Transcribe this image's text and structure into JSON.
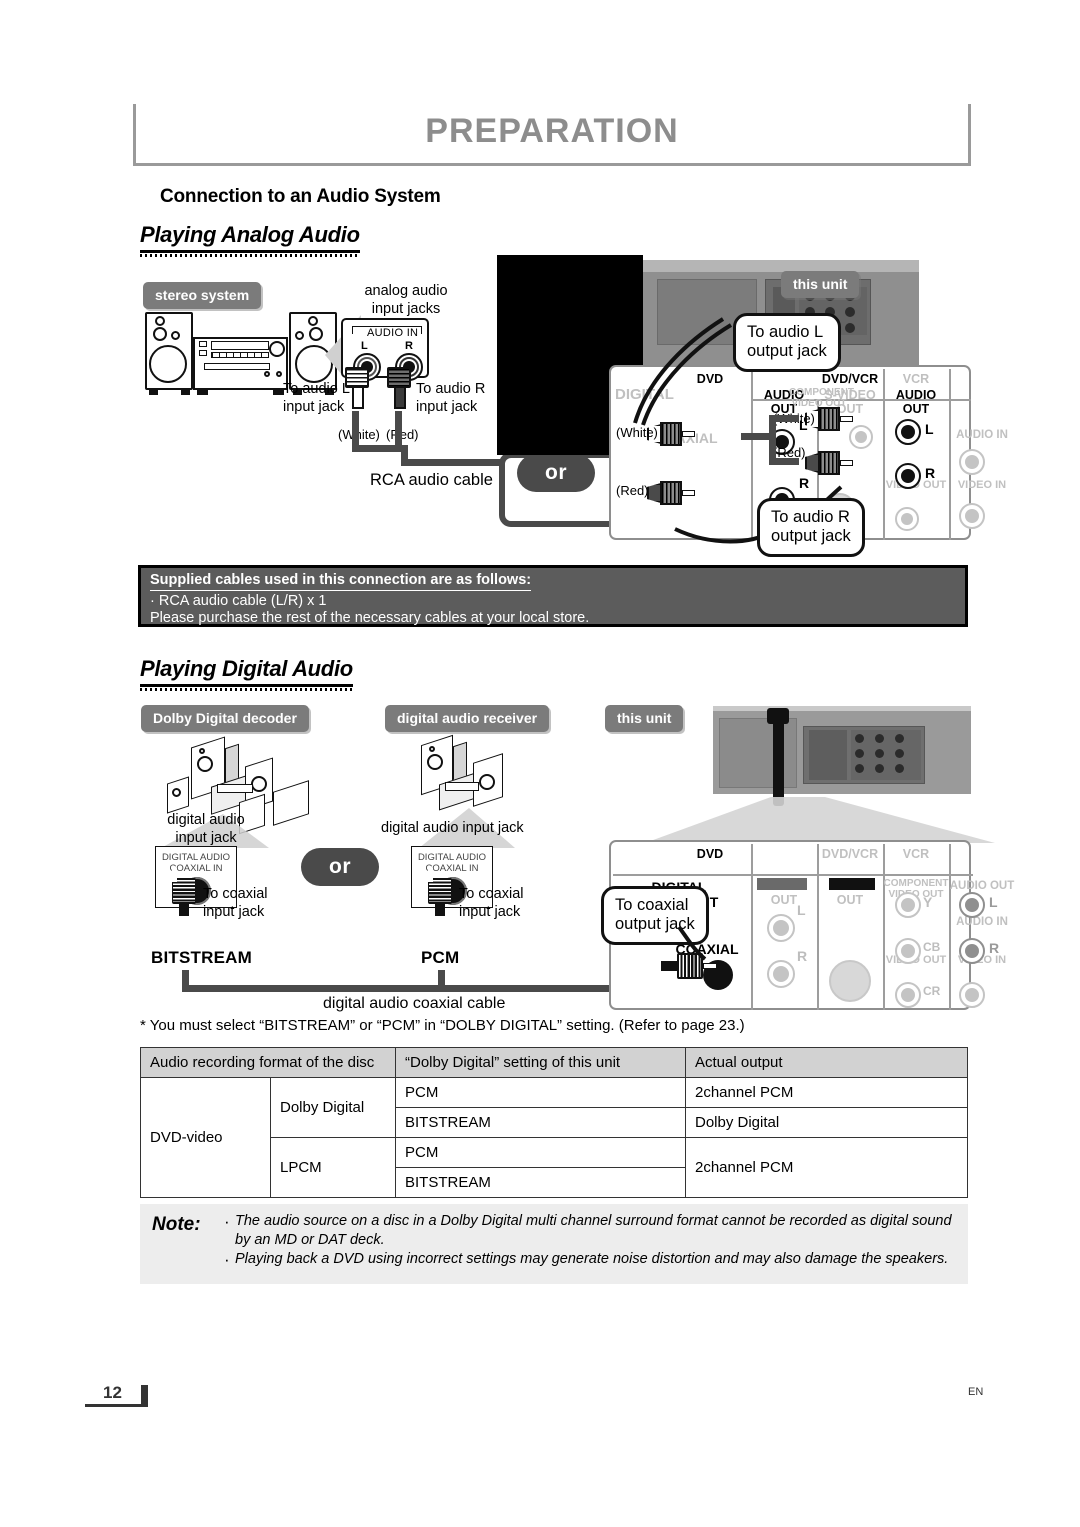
{
  "header": {
    "title": "PREPARATION"
  },
  "section": {
    "title": "Connection to an Audio System",
    "analog_heading": "Playing Analog Audio",
    "digital_heading": "Playing Digital Audio"
  },
  "analog": {
    "label_stereo_system": "stereo system",
    "label_this_unit": "this unit",
    "caption_analog_jacks": "analog audio\ninput jacks",
    "jackpanel_title": "AUDIO IN",
    "jackpanel_l": "L",
    "jackpanel_r": "R",
    "caption_to_audio_l_in": "To audio L\ninput jack",
    "caption_to_audio_r_in": "To audio R\ninput jack",
    "color_white": "(White)",
    "color_red": "(Red)",
    "caption_rca_cable": "RCA audio cable",
    "or_label": "or",
    "bubble_audio_l_out": "To audio L\noutput jack",
    "bubble_audio_r_out": "To audio R\noutput jack",
    "panel": {
      "dvd": "DVD",
      "dvd_vcr": "DVD/VCR",
      "vcr": "VCR",
      "digital": "DIGITAL",
      "audio_out_top": "AUDIO OUT",
      "audio_out": "AUDIO\nOUT",
      "s_video_out": "S-VIDEO\nOUT",
      "component_video_out": "COMPONENT\nVIDEO OUT",
      "coaxial": "COAXIAL",
      "audio_in": "AUDIO IN",
      "video_out": "VIDEO OUT",
      "video_in": "VIDEO IN",
      "l": "L",
      "r": "R"
    }
  },
  "supplied": {
    "heading": "Supplied cables used in this connection are as follows:",
    "item": "· RCA audio cable (L/R) x 1",
    "note": "Please purchase the rest of the necessary cables at your local store."
  },
  "digital": {
    "label_dolby_decoder": "Dolby Digital decoder",
    "label_receiver": "digital audio receiver",
    "label_this_unit": "this unit",
    "caption_jack_left": "digital audio\ninput jack",
    "caption_jack_right": "digital audio input jack",
    "dpanel_text": "DIGITAL AUDIO\nCOAXIAL IN",
    "caption_to_coaxial_in": "To coaxial\ninput jack",
    "word_bitstream": "BITSTREAM",
    "word_pcm": "PCM",
    "caption_coax_cable": "digital audio coaxial cable",
    "or_label": "or",
    "bubble_to_coaxial_out": "To coaxial\noutput jack",
    "panel": {
      "dvd": "DVD",
      "dvd_vcr": "DVD/VCR",
      "vcr": "VCR",
      "digital_audio_out": "DIGITAL\nAUDIO OUT",
      "audio_out": "AUDIO\nOUT",
      "out": "OUT",
      "component_video_out": "COMPONENT\nVIDEO OUT",
      "audio_out_right": "AUDIO OUT",
      "audio_in": "AUDIO IN",
      "video_out": "VIDEO OUT",
      "video_in": "VIDEO IN",
      "coaxial": "COAXIAL",
      "l": "L",
      "r": "R",
      "y": "Y",
      "cb": "CB",
      "cr": "CR"
    }
  },
  "footnote": "* You must select “BITSTREAM” or “PCM” in “DOLBY DIGITAL” setting. (Refer to page 23.)",
  "table": {
    "headers": [
      "Audio recording format of the disc",
      "“Dolby Digital” setting of this unit",
      "Actual output"
    ],
    "disc_format": "DVD-video",
    "groups": [
      {
        "name": "Dolby Digital",
        "rows": [
          {
            "setting": "PCM",
            "output": "2channel PCM"
          },
          {
            "setting": "BITSTREAM",
            "output": "Dolby Digital"
          }
        ]
      },
      {
        "name": "LPCM",
        "rows": [
          {
            "setting": "PCM",
            "output": "2channel PCM"
          },
          {
            "setting": "BITSTREAM",
            "output": ""
          }
        ]
      }
    ]
  },
  "note": {
    "label": "Note:",
    "items": [
      "The audio source on a disc in a Dolby Digital multi channel surround format cannot be recorded as digital sound by an MD or DAT deck.",
      "Playing back a DVD using incorrect settings may generate noise distortion and may also damage the speakers."
    ]
  },
  "footer": {
    "page": "12",
    "lang": "EN"
  }
}
